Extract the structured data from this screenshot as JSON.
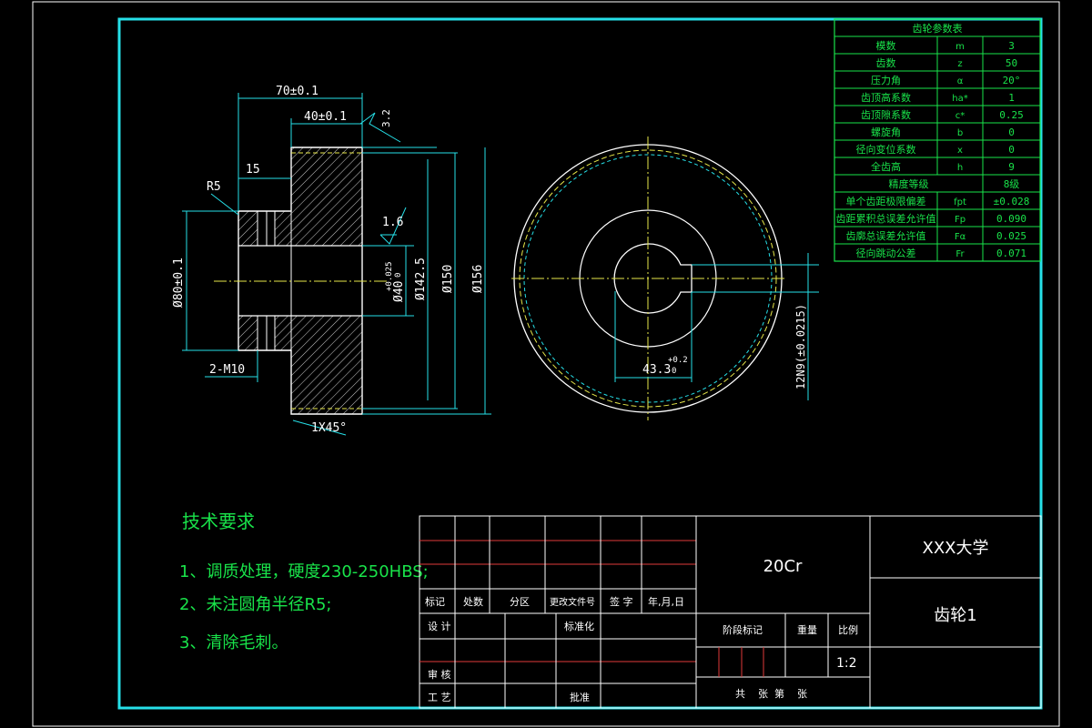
{
  "param_table": {
    "title": "齿轮参数表",
    "rows": [
      {
        "name": "模数",
        "symbol": "m",
        "value": "3"
      },
      {
        "name": "齿数",
        "symbol": "z",
        "value": "50"
      },
      {
        "name": "压力角",
        "symbol": "α",
        "value": "20°"
      },
      {
        "name": "齿顶高系数",
        "symbol": "ha*",
        "value": "1"
      },
      {
        "name": "齿顶隙系数",
        "symbol": "c*",
        "value": "0.25"
      },
      {
        "name": "螺旋角",
        "symbol": "b",
        "value": "0"
      },
      {
        "name": "径向变位系数",
        "symbol": "x",
        "value": "0"
      },
      {
        "name": "全齿高",
        "symbol": "h",
        "value": "9"
      },
      {
        "name": "精度等级",
        "symbol": "",
        "value": "8级"
      },
      {
        "name": "单个齿距极限偏差",
        "symbol": "fpt",
        "value": "±0.028"
      },
      {
        "name": "齿距累积总误差允许值",
        "symbol": "Fp",
        "value": "0.090"
      },
      {
        "name": "齿廓总误差允许值",
        "symbol": "Fα",
        "value": "0.025"
      },
      {
        "name": "径向跳动公差",
        "symbol": "Fr",
        "value": "0.071"
      }
    ]
  },
  "dimensions": {
    "len_70": "70±0.1",
    "len_40": "40±0.1",
    "len_15": "15",
    "radius": "R5",
    "dia_80": "Ø80±0.1",
    "dia_40": "Ø40",
    "dia_40_tol_upper": "+0.025",
    "dia_40_tol_lower": "0",
    "dia_1425": "Ø142.5",
    "dia_150": "Ø150",
    "dia_156": "Ø156",
    "thread": "2-M10",
    "chamfer": "1X45°",
    "rough_32": "3.2",
    "rough_16": "1.6",
    "keyway_depth": "43.3",
    "keyway_tol_upper": "+0.2",
    "keyway_tol_lower": "0",
    "keyway_width": "12N9(±0.0215)"
  },
  "tech_req": {
    "title": "技术要求",
    "items": [
      "1、调质处理，硬度230-250HBS;",
      "2、未注圆角半径R5;",
      "3、清除毛刺。"
    ]
  },
  "title_block": {
    "material": "20Cr",
    "university": "XXX大学",
    "part_name": "齿轮1",
    "scale": "1:2",
    "labels": {
      "biaoji": "标记",
      "chushu": "处数",
      "fenqu": "分区",
      "genggai": "更改文件号",
      "qianzi": "签 字",
      "date": "年,月,日",
      "sheji": "设 计",
      "biaozhunhua": "标准化",
      "jieduan": "阶段标记",
      "zhongliang": "重量",
      "bili": "比例",
      "shenhe": "审 核",
      "gongyi": "工 艺",
      "pizhun": "批准",
      "sheets": "共    张  第    张"
    }
  },
  "colors": {
    "frame": "#26e0e8",
    "outline": "#ffffff",
    "table_grid": "#19e34a",
    "table_text": "#19e34a",
    "hatch": "#d8d8d8",
    "center_line": "#e8e84a",
    "red_line": "#e03a3a",
    "note_text": "#19e34a"
  }
}
